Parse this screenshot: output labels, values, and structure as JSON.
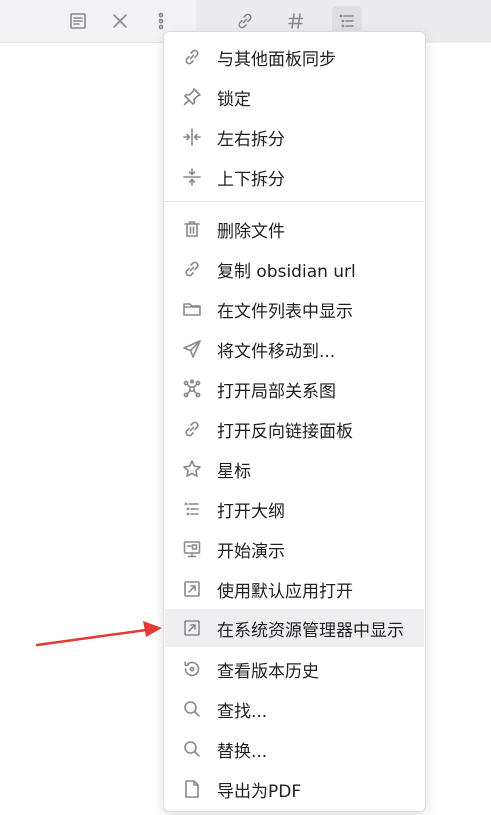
{
  "toolbar": {
    "left_icons": [
      "reading-view-icon",
      "close-icon",
      "more-options-icon"
    ],
    "right_icons": [
      "links-icon",
      "tags-icon",
      "outline-icon"
    ]
  },
  "menu": {
    "items": [
      {
        "label": "与其他面板同步",
        "icon": "link-icon"
      },
      {
        "label": "锁定",
        "icon": "pin-icon"
      },
      {
        "label": "左右拆分",
        "icon": "split-vertical-icon"
      },
      {
        "label": "上下拆分",
        "icon": "split-horizontal-icon"
      },
      {
        "label": "删除文件",
        "icon": "trash-icon"
      },
      {
        "label": "复制 obsidian url",
        "icon": "link-icon"
      },
      {
        "label": "在文件列表中显示",
        "icon": "folder-icon"
      },
      {
        "label": "将文件移动到...",
        "icon": "send-icon"
      },
      {
        "label": "打开局部关系图",
        "icon": "graph-icon"
      },
      {
        "label": "打开反向链接面板",
        "icon": "link-icon"
      },
      {
        "label": "星标",
        "icon": "star-icon"
      },
      {
        "label": "打开大纲",
        "icon": "outline-icon"
      },
      {
        "label": "开始演示",
        "icon": "presentation-icon"
      },
      {
        "label": "使用默认应用打开",
        "icon": "open-external-icon"
      },
      {
        "label": "在系统资源管理器中显示",
        "icon": "open-external-icon"
      },
      {
        "label": "查看版本历史",
        "icon": "history-icon"
      },
      {
        "label": "查找...",
        "icon": "search-icon"
      },
      {
        "label": "替换...",
        "icon": "search-icon"
      },
      {
        "label": "导出为PDF",
        "icon": "file-icon"
      }
    ],
    "highlighted_label": "在系统资源管理器中显示"
  },
  "colors": {
    "highlight_bg": "#efeff2",
    "annotation_arrow": "#e53935"
  }
}
